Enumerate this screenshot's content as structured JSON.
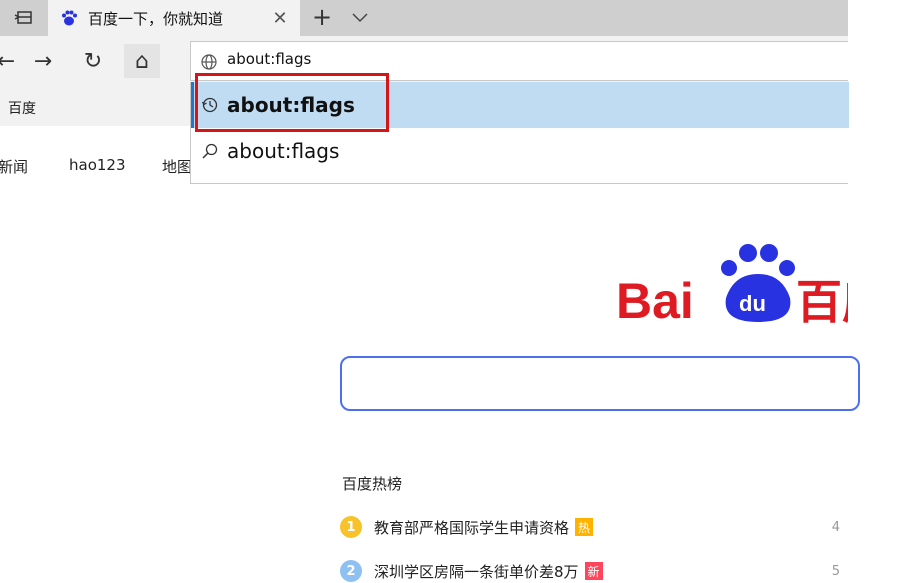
{
  "browser": {
    "tab": {
      "title": "百度一下，你就知道",
      "close_glyph": "✕"
    },
    "new_tab_glyph": "+",
    "toolbar": {
      "back_glyph": "←",
      "forward_glyph": "→",
      "refresh_glyph": "↻",
      "home_glyph": "⌂"
    },
    "address": {
      "value": "about:flags"
    },
    "suggestions": [
      {
        "text": "about:flags",
        "icon": "history-icon",
        "selected": true
      },
      {
        "text": "about:flags",
        "icon": "search-icon",
        "selected": false
      }
    ],
    "favorites": {
      "item": "百度"
    },
    "accent_color": "#2b73c7",
    "highlight_color": "#d4161b"
  },
  "page": {
    "nav_links": [
      "新闻",
      "hao123",
      "地图"
    ],
    "logo": {
      "text": "Bai",
      "paw_text": "du",
      "chinese": "百度"
    },
    "hot_list": {
      "title": "百度热榜",
      "items": [
        {
          "rank": "1",
          "text": "教育部严格国际学生申请资格",
          "badge": "热",
          "badge_color": "#ff9b00",
          "side": "4"
        },
        {
          "rank": "2",
          "text": "深圳学区房隔一条街单价差8万",
          "badge": "新",
          "badge_color": "#ff455b",
          "side": "5"
        }
      ]
    },
    "brand_red": "#de1a22",
    "brand_blue": "#2932e1"
  }
}
